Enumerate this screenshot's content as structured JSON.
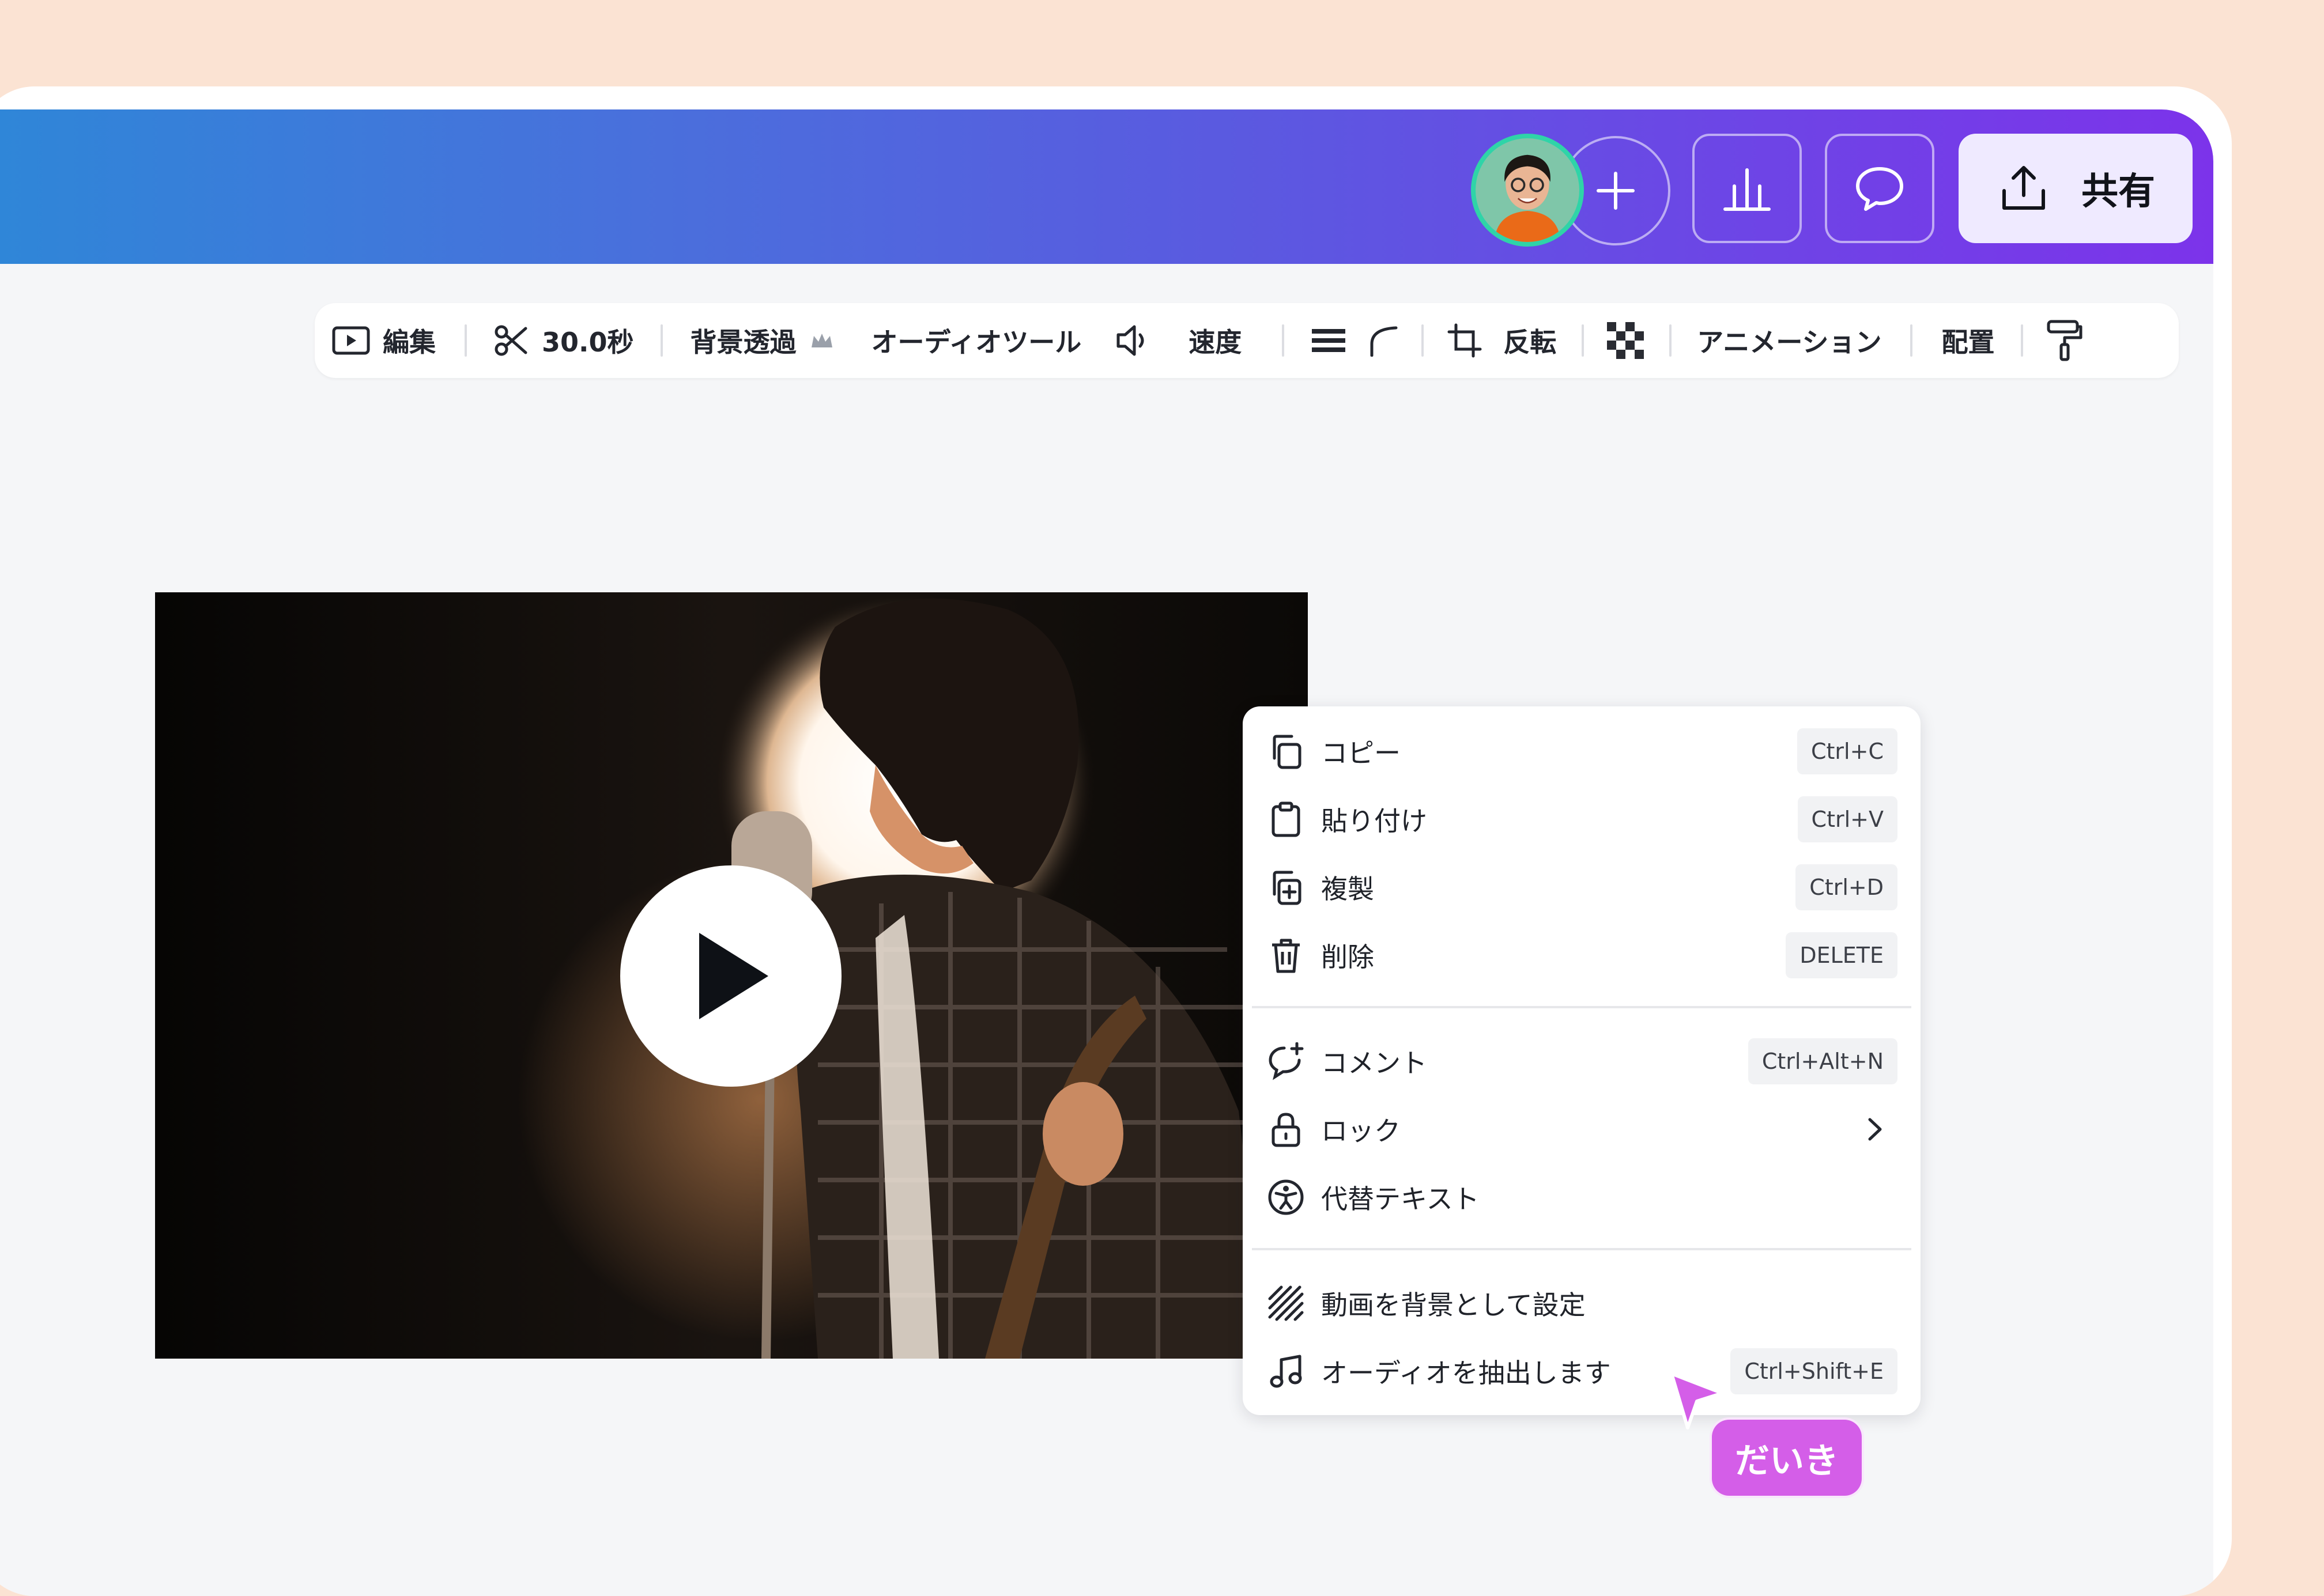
{
  "topbar": {
    "add_icon": "plus-icon",
    "insights_icon": "bar-chart-icon",
    "comment_icon": "speech-bubble-icon",
    "share_icon": "upload-icon",
    "share_label": "共有"
  },
  "toolbar": {
    "edit_label": "編集",
    "duration_label": "30.0秒",
    "bg_remove_label": "背景透過",
    "audio_tools_label": "オーディオツール",
    "speed_label": "速度",
    "flip_label": "反転",
    "animation_label": "アニメーション",
    "position_label": "配置"
  },
  "menu": {
    "items": [
      {
        "label": "コピー",
        "shortcut": "Ctrl+C",
        "icon": "copy-icon"
      },
      {
        "label": "貼り付け",
        "shortcut": "Ctrl+V",
        "icon": "clipboard-icon"
      },
      {
        "label": "複製",
        "shortcut": "Ctrl+D",
        "icon": "duplicate-icon"
      },
      {
        "label": "削除",
        "shortcut": "DELETE",
        "icon": "trash-icon"
      },
      {
        "label": "コメント",
        "shortcut": "Ctrl+Alt+N",
        "icon": "add-comment-icon"
      },
      {
        "label": "ロック",
        "icon": "lock-icon"
      },
      {
        "label": "代替テキスト",
        "icon": "accessibility-icon"
      },
      {
        "label": "動画を背景として設定",
        "icon": "hatch-pattern-icon"
      },
      {
        "label": "オーディオを抽出します",
        "shortcut": "Ctrl+Shift+E",
        "icon": "music-note-icon"
      }
    ]
  },
  "cursor": {
    "name": "だいき",
    "color": "#d45ee8"
  },
  "colors": {
    "page_bg": "#fbe3d3",
    "gradient_start": "#2f86d8",
    "gradient_end": "#7c33ea",
    "share_bg": "#efeaff"
  }
}
